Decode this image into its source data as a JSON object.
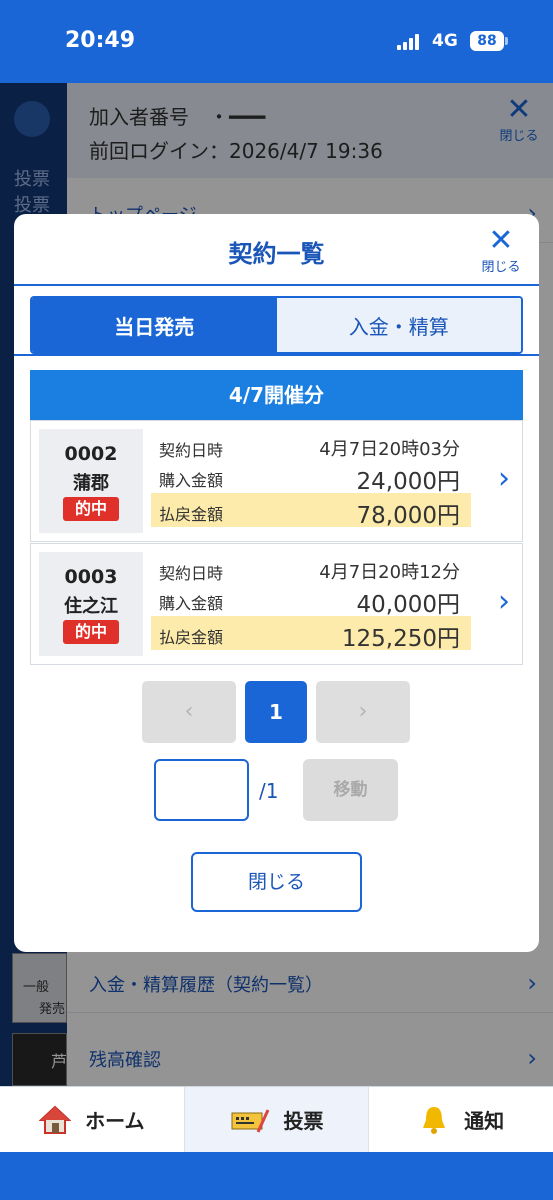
{
  "status_bar": {
    "time": "20:49",
    "network": "4G",
    "battery": "88"
  },
  "background": {
    "header_line1": "加入者番号　・━━━",
    "header_line2": "前回ログイン：2026/4/7 19:36",
    "close_label": "閉じる",
    "menu_items": [
      {
        "label": "トップページ"
      },
      {
        "label": "入金・精算履歴（契約一覧）"
      },
      {
        "label": "残高確認"
      }
    ],
    "left_text_1": "投票",
    "left_text_2": "投票",
    "left_text_3": "一般",
    "left_text_4": "発売",
    "left_text_5": "芦"
  },
  "modal": {
    "title": "契約一覧",
    "close_label": "閉じる",
    "tabs": [
      {
        "label": "当日発売",
        "active": true
      },
      {
        "label": "入金・精算",
        "active": false
      }
    ],
    "date_banner": "4/7開催分",
    "labels": {
      "contract_time": "契約日時",
      "purchase_amount": "購入金額",
      "refund_amount": "払戻金額"
    },
    "contracts": [
      {
        "number": "0002",
        "venue": "蒲郡",
        "status": "的中",
        "contract_time": "4月7日20時03分",
        "purchase_amount": "24,000円",
        "refund_amount": "78,000円"
      },
      {
        "number": "0003",
        "venue": "住之江",
        "status": "的中",
        "contract_time": "4月7日20時12分",
        "purchase_amount": "40,000円",
        "refund_amount": "125,250円"
      }
    ],
    "pager": {
      "prev": "‹",
      "next": "›",
      "current": "1",
      "total": "/1",
      "page_input_value": "",
      "move_label": "移動"
    },
    "close_button": "閉じる"
  },
  "bottom_nav": [
    {
      "label": "ホーム",
      "icon": "home-icon"
    },
    {
      "label": "投票",
      "icon": "ticket-icon",
      "active": true
    },
    {
      "label": "通知",
      "icon": "bell-icon"
    }
  ],
  "colors": {
    "primary": "#1a66d6",
    "hit_badge": "#e0302a",
    "refund_band": "#fcebaa"
  }
}
